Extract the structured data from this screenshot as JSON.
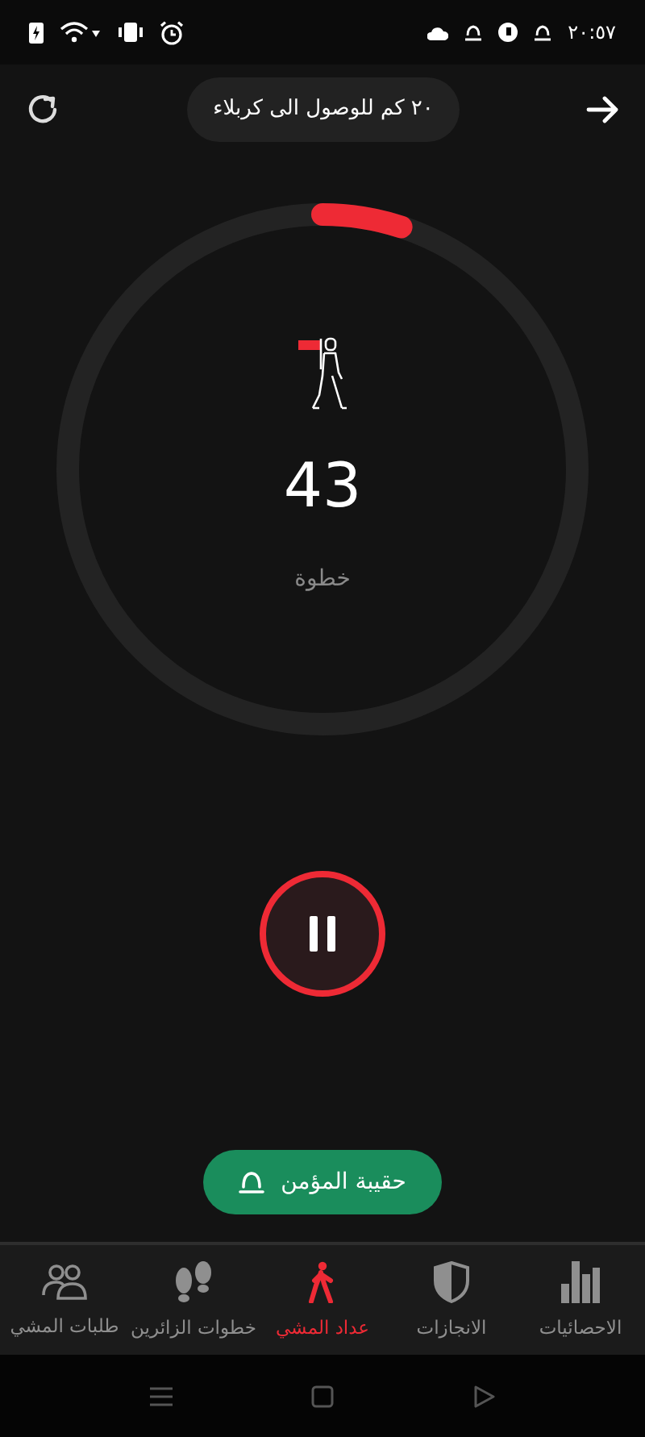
{
  "status_bar": {
    "time": "٢٠:٥٧"
  },
  "header": {
    "distance": "٢٠ كم للوصول الى كربلاء"
  },
  "counter": {
    "level": 0.05,
    "steps": "43",
    "unit": "خطوة",
    "running": true
  },
  "bag_button": {
    "label": "حقيبة المؤمن"
  },
  "nav": [
    {
      "kind": "stats",
      "label": "الاحصائيات",
      "selected": false
    },
    {
      "kind": "achievements",
      "label": "الانجازات",
      "selected": false
    },
    {
      "kind": "walker",
      "label": "عداد المشي",
      "selected": true
    },
    {
      "kind": "footsteps",
      "label": "خطوات الزائرين",
      "selected": false
    },
    {
      "kind": "people",
      "label": "طلبات المشي",
      "selected": false
    }
  ]
}
